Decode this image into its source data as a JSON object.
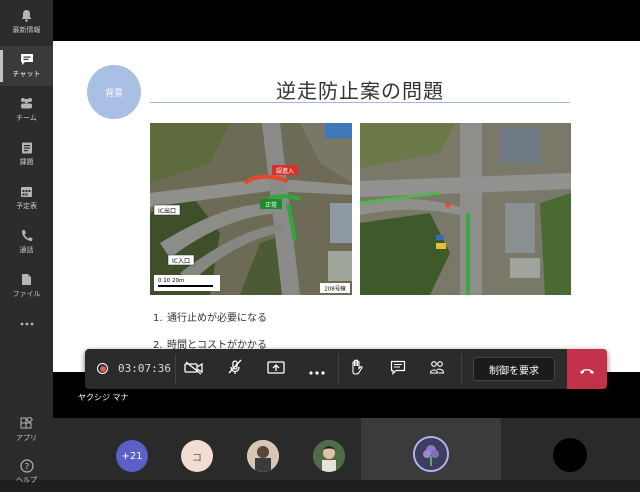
{
  "rail": {
    "items": [
      {
        "label": "最新情報",
        "icon": "bell-icon"
      },
      {
        "label": "チャット",
        "icon": "chat-icon",
        "active": true
      },
      {
        "label": "チーム",
        "icon": "teams-icon"
      },
      {
        "label": "課題",
        "icon": "assignments-icon"
      },
      {
        "label": "予定表",
        "icon": "calendar-icon"
      },
      {
        "label": "通話",
        "icon": "phone-icon"
      },
      {
        "label": "ファイル",
        "icon": "file-icon"
      },
      {
        "label": "…",
        "icon": "more-icon"
      }
    ],
    "bottom": [
      {
        "label": "アプリ",
        "icon": "apps-icon"
      },
      {
        "label": "ヘルプ",
        "icon": "help-icon"
      }
    ]
  },
  "slide": {
    "badge": "背景",
    "title": "逆走防止案の問題",
    "map_labels": {
      "wrong_way": "誤進入",
      "correct": "正常",
      "ic_exit": "IC出口",
      "ic_entrance": "IC入口",
      "scale": "0    10    20m",
      "route": "208号線"
    },
    "list": [
      {
        "num": "1.",
        "text": "通行止めが必要になる"
      },
      {
        "num": "2.",
        "text": "時間とコストがかかる"
      }
    ]
  },
  "toolbar": {
    "timer": "03:07:36",
    "request_control": "制御を要求",
    "colors": {
      "hangup": "#c4314b",
      "record": "#e05b5b"
    }
  },
  "participant_name": "ヤクシジ マナ",
  "participants": {
    "overflow": "+21",
    "initial": "コ"
  }
}
